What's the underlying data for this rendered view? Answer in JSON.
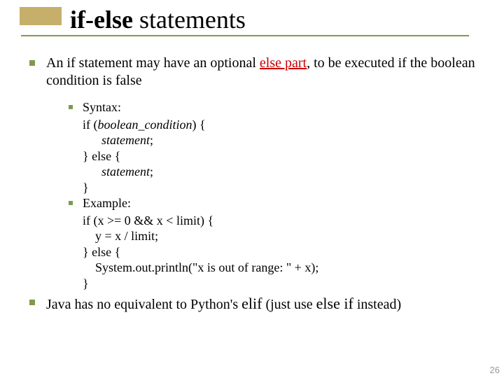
{
  "title": {
    "if_else": "if-else",
    "rest": " statements"
  },
  "bullets": {
    "b1_pre": "An if statement may have an optional ",
    "b1_red": "else part",
    "b1_post": ", to be executed if the boolean condition is false",
    "syntax_label": "Syntax:",
    "syntax": {
      "l1_kw_if": "if",
      "l1_paren_open": " (",
      "l1_cond": "boolean_condition",
      "l1_paren_close_brace": ") {",
      "l2_stmt": "statement",
      "l2_semi": ";",
      "l3_close_else": "} else {",
      "l4_stmt": "statement",
      "l4_semi": ";",
      "l5_close": "}"
    },
    "example_label": "Example:",
    "example": {
      "l1": "if (x >= 0 && x < limit) {",
      "l2": "    y = x / limit;",
      "l3": "} else {",
      "l4": "    System.out.println(\"x is out of range: \" + x);",
      "l5": "}"
    },
    "b3_pre": "Java has no equivalent to Python's ",
    "b3_elif": "elif",
    "b3_mid": " (just use ",
    "b3_elseif": "else if",
    "b3_post": " instead)"
  },
  "page_number": "26"
}
